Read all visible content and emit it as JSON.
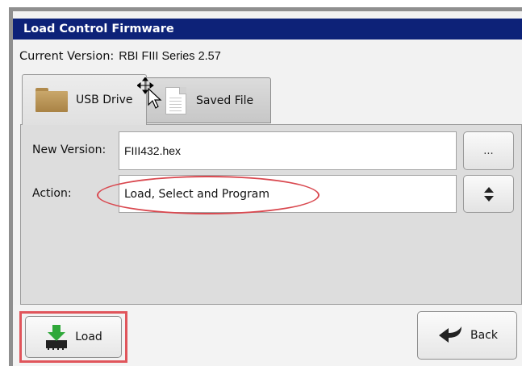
{
  "window": {
    "title": "Load Control Firmware"
  },
  "version": {
    "label": "Current Version:",
    "value": "RBI FIII Series 2.57"
  },
  "tabs": [
    {
      "label": "USB Drive",
      "icon": "folder-icon",
      "selected": true
    },
    {
      "label": "Saved File",
      "icon": "document-icon",
      "selected": false
    }
  ],
  "form": {
    "new_version_label": "New Version:",
    "new_version_value": "FIII432.hex",
    "browse_label": "...",
    "action_label": "Action:",
    "action_value": "Load, Select and Program",
    "action_spinner_icon": "up-down-arrows-icon"
  },
  "buttons": {
    "load_label": "Load",
    "load_icon": "download-chip-icon",
    "back_label": "Back",
    "back_icon": "back-arrow-icon"
  },
  "colors": {
    "title_bar": "#0d2278",
    "highlight_red": "#e0555b",
    "load_icon_green": "#2fa83a"
  }
}
